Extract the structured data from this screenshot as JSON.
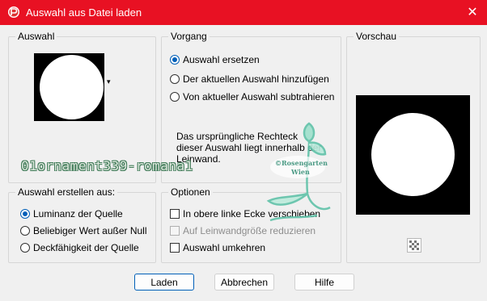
{
  "window": {
    "title": "Auswahl aus Datei laden",
    "close_glyph": "✕"
  },
  "auswahl_group": {
    "legend": "Auswahl",
    "dropdown_glyph": "▾"
  },
  "vorgang_group": {
    "legend": "Vorgang",
    "options": [
      {
        "label": "Auswahl ersetzen",
        "checked": true
      },
      {
        "label": "Der aktuellen Auswahl hinzufügen",
        "checked": false
      },
      {
        "label": "Von aktueller Auswahl subtrahieren",
        "checked": false
      }
    ],
    "description": "Das ursprüngliche Rechteck dieser Auswahl liegt innerhalb der Leinwand."
  },
  "vorschau_group": {
    "legend": "Vorschau"
  },
  "erstellen_group": {
    "legend": "Auswahl erstellen aus:",
    "options": [
      {
        "label": "Luminanz der Quelle",
        "checked": true
      },
      {
        "label": "Beliebiger Wert außer Null",
        "checked": false
      },
      {
        "label": "Deckfähigkeit der Quelle",
        "checked": false
      }
    ]
  },
  "optionen_group": {
    "legend": "Optionen",
    "checks": [
      {
        "label": "In obere linke Ecke verschieben",
        "checked": false,
        "disabled": false
      },
      {
        "label": "Auf Leinwandgröße reduzieren",
        "checked": false,
        "disabled": true
      },
      {
        "label": "Auswahl umkehren",
        "checked": false,
        "disabled": false
      }
    ]
  },
  "buttons": {
    "load": "Laden",
    "cancel": "Abbrechen",
    "help": "Hilfe"
  },
  "watermark": {
    "text": "01ornament339-romana1",
    "stamp_line1": "©Rosengarten",
    "stamp_line2": "Wien"
  },
  "colors": {
    "titlebar": "#e81123",
    "accent": "#005fb8"
  }
}
